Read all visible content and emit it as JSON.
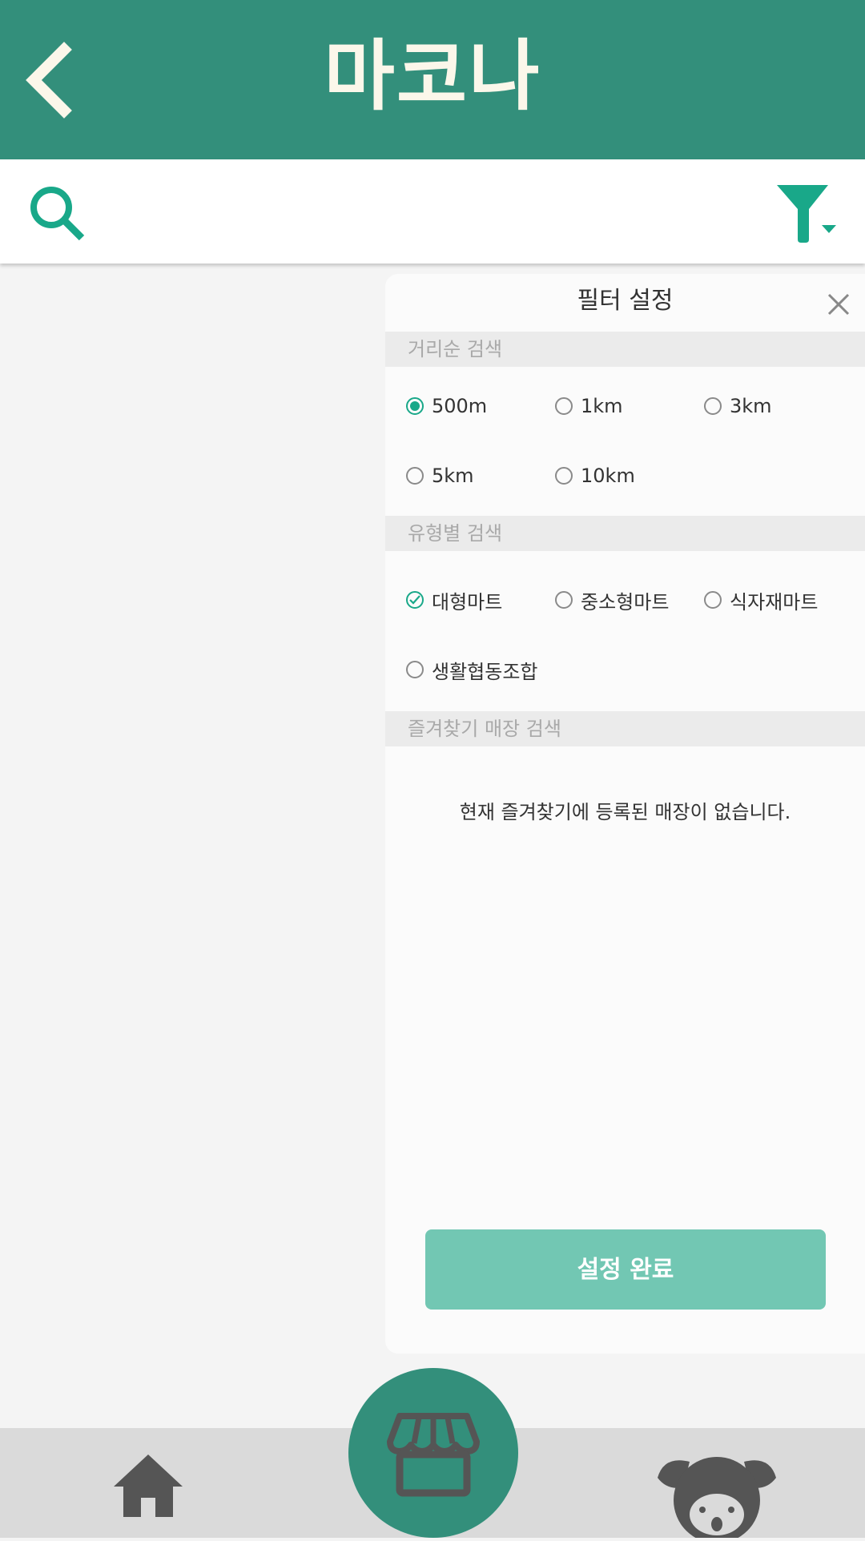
{
  "appbar": {
    "title": "마코나",
    "back_icon": "chevron-left-icon"
  },
  "searchbar": {
    "search_icon": "search-icon",
    "filter_icon": "filter-icon"
  },
  "filter_panel": {
    "title": "필터 설정",
    "close_icon": "close-icon",
    "distance": {
      "header": "거리순 검색",
      "options": [
        {
          "label": "500m",
          "selected": true
        },
        {
          "label": "1km",
          "selected": false
        },
        {
          "label": "3km",
          "selected": false
        },
        {
          "label": "5km",
          "selected": false
        },
        {
          "label": "10km",
          "selected": false
        }
      ]
    },
    "type": {
      "header": "유형별 검색",
      "options": [
        {
          "label": "대형마트",
          "checked": true
        },
        {
          "label": "중소형마트",
          "checked": false
        },
        {
          "label": "식자재마트",
          "checked": false
        },
        {
          "label": "생활협동조합",
          "checked": false
        }
      ]
    },
    "favorites": {
      "header": "즐겨찾기 매장 검색",
      "empty_message": "현재 즐겨찾기에 등록된 매장이 없습니다."
    },
    "done_button": "설정 완료"
  },
  "bottom_nav": {
    "home_icon": "home-icon",
    "store_icon": "store-icon",
    "profile_icon": "koala-icon"
  },
  "colors": {
    "primary": "#338f7b",
    "accent": "#19a889",
    "button": "#72c7b3"
  }
}
